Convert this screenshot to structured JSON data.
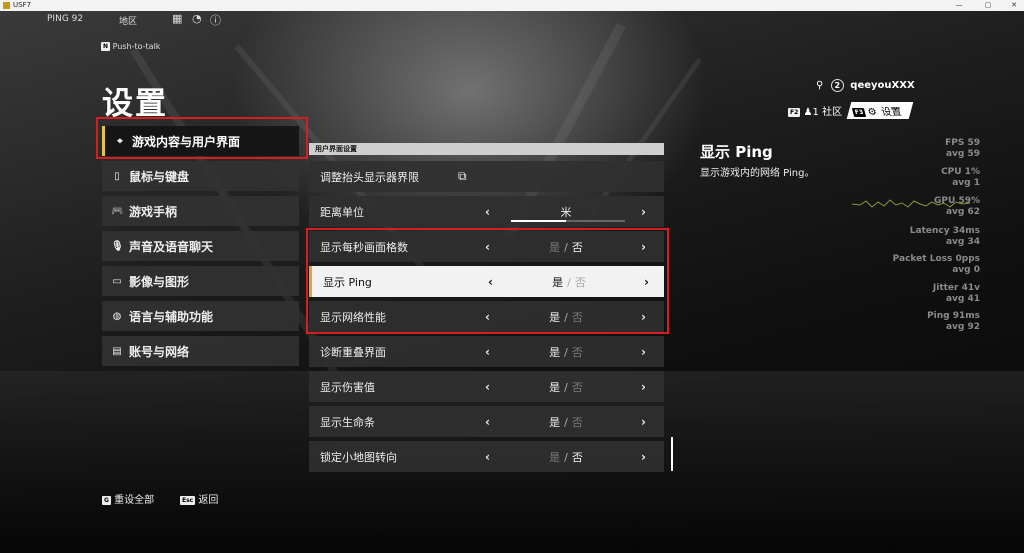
{
  "window": {
    "title": "USF7",
    "controls": [
      "—",
      "▢",
      "✕"
    ]
  },
  "topbar": {
    "ping": "PING 92",
    "region": "地区"
  },
  "ptt": {
    "key": "N",
    "label": "Push-to-talk"
  },
  "page_title": "设置",
  "nav": [
    {
      "icon": "crosshair-icon",
      "glyph": "⌖",
      "label": "游戏内容与用户界面",
      "active": true
    },
    {
      "icon": "mouse-icon",
      "glyph": "▯",
      "label": "鼠标与键盘"
    },
    {
      "icon": "gamepad-icon",
      "glyph": "🎮",
      "label": "游戏手柄"
    },
    {
      "icon": "microphone-icon",
      "glyph": "🎙",
      "label": "声音及语音聊天"
    },
    {
      "icon": "display-icon",
      "glyph": "▭",
      "label": "影像与图形"
    },
    {
      "icon": "globe-icon",
      "glyph": "◍",
      "label": "语言与辅助功能"
    },
    {
      "icon": "account-icon",
      "glyph": "▤",
      "label": "账号与网络"
    }
  ],
  "section_header": "用户界面设置",
  "rows": [
    {
      "label": "调整抬头显示器界限",
      "kind": "link"
    },
    {
      "label": "距离单位",
      "kind": "slider",
      "value": "米"
    },
    {
      "label": "显示每秒画面格数",
      "kind": "toggle",
      "yes": "是",
      "sep": "/",
      "no": "否",
      "selected_value": "否"
    },
    {
      "label": "显示 Ping",
      "kind": "toggle",
      "yes": "是",
      "sep": "/",
      "no": "否",
      "selected_value": "是",
      "selected": true
    },
    {
      "label": "显示网络性能",
      "kind": "toggle",
      "yes": "是",
      "sep": "/",
      "no": "否",
      "selected_value": "是"
    },
    {
      "label": "诊断重叠界面",
      "kind": "toggle",
      "yes": "是",
      "sep": "/",
      "no": "否",
      "selected_value": "是"
    },
    {
      "label": "显示伤害值",
      "kind": "toggle",
      "yes": "是",
      "sep": "/",
      "no": "否",
      "selected_value": "是"
    },
    {
      "label": "显示生命条",
      "kind": "toggle",
      "yes": "是",
      "sep": "/",
      "no": "否",
      "selected_value": "是"
    },
    {
      "label": "锁定小地图转向",
      "kind": "toggle",
      "yes": "是",
      "sep": "/",
      "no": "否",
      "selected_value": "否"
    }
  ],
  "user": {
    "level": "2",
    "name": "qeeyouXXX"
  },
  "tabs": {
    "community_key": "F2",
    "community_count": "1",
    "community_label": "社区",
    "settings_key": "F3",
    "settings_label": "设置"
  },
  "description": {
    "title": "显示 Ping",
    "text": "显示游戏内的网络 Ping。"
  },
  "perf": [
    {
      "l1": "FPS 59",
      "l2": "avg 59"
    },
    {
      "l1": "CPU 1%",
      "l2": "avg 1"
    },
    {
      "l1": "GPU 59%",
      "l2": "avg 62"
    },
    {
      "l1": "Latency 34ms",
      "l2": "avg 34"
    },
    {
      "l1": "Packet Loss 0pps",
      "l2": "avg 0"
    },
    {
      "l1": "Jitter 41v",
      "l2": "avg 41"
    },
    {
      "l1": "Ping 91ms",
      "l2": "avg 92"
    }
  ],
  "footer": {
    "reset_key": "G",
    "reset_label": "重设全部",
    "back_key": "Esc",
    "back_label": "返回"
  },
  "colors": {
    "highlight_red": "#d41f1f",
    "accent_yellow": "#e2c34a"
  }
}
